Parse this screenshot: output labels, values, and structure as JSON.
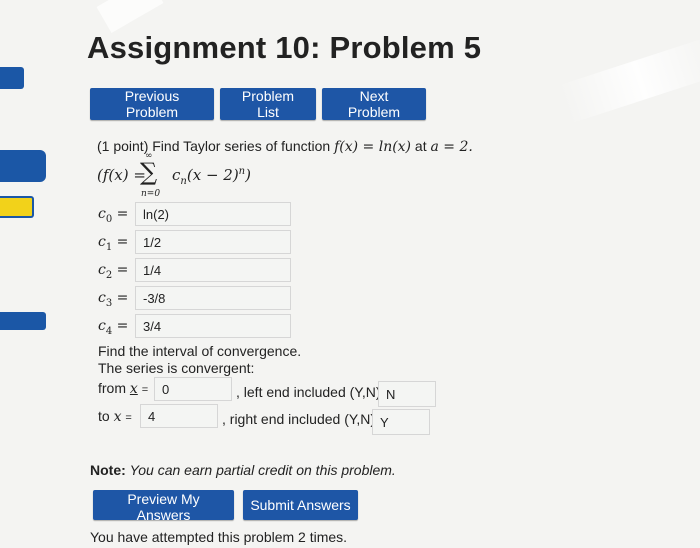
{
  "page": {
    "title": "Assignment 10: Problem 5"
  },
  "nav": {
    "prev_label": "Previous Problem",
    "list_label": "Problem List",
    "next_label": "Next Problem"
  },
  "problem": {
    "points": "(1 point) Find Taylor series of function",
    "function": "f(x) = ln(x)",
    "at_text": "at",
    "center": "a = 2.",
    "series_lhs": "(f(x) =",
    "series_rhs": "c",
    "series_term": "(x − 2)",
    "series_exp": "n",
    "series_close": ")",
    "sum_top": "∞",
    "sum_bottom": "n=0"
  },
  "coefficients": [
    {
      "label": "c",
      "index": "0",
      "value": "ln(2)"
    },
    {
      "label": "c",
      "index": "1",
      "value": "1/2"
    },
    {
      "label": "c",
      "index": "2",
      "value": "1/4"
    },
    {
      "label": "c",
      "index": "3",
      "value": "-3/8"
    },
    {
      "label": "c",
      "index": "4",
      "value": "3/4"
    }
  ],
  "interval": {
    "heading": "Find the interval of convergence.",
    "status": "The series is convergent:",
    "from_label": "from",
    "to_label": "to",
    "x_var": "x",
    "eq": "=",
    "from_value": "0",
    "to_value": "4",
    "left_label": ", left end included (Y,N):",
    "right_label": ", right end included (Y,N):",
    "left_value": "N",
    "right_value": "Y"
  },
  "note": {
    "bold": "Note:",
    "text": "You can earn partial credit on this problem."
  },
  "actions": {
    "preview_label": "Preview My Answers",
    "submit_label": "Submit Answers"
  },
  "attempts": "You have attempted this problem 2 times."
}
